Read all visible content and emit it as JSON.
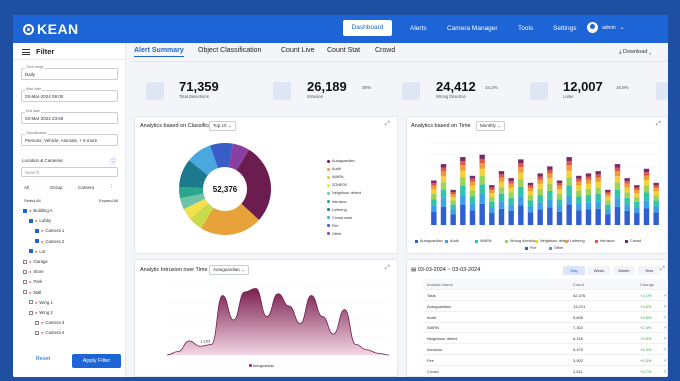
{
  "brand": "KEAN",
  "nav": {
    "active": "Dashboard",
    "items": [
      "Alerts",
      "Camera Manager",
      "Tools",
      "Settings"
    ],
    "user": "admin"
  },
  "sidebar": {
    "title": "Filter",
    "fields": [
      {
        "label": "Time range",
        "value": "Daily"
      },
      {
        "label": "Start date",
        "value": "03-Mar-2024 09:00"
      },
      {
        "label": "End date",
        "value": "03-Mar-2024 23:59"
      },
      {
        "label": "Classification",
        "value": "Persons, Vehicle, Animals, + 5 more"
      }
    ],
    "location_label": "Location & Cameras",
    "search_placeholder": "Search",
    "chips": [
      "All",
      "Group",
      "Camera"
    ],
    "select_all": "Select All",
    "expand_all": "Expand All",
    "tree": [
      {
        "label": "Building A",
        "level": 0,
        "checked": true
      },
      {
        "label": "Lobby",
        "level": 1,
        "checked": true
      },
      {
        "label": "Camera 1",
        "level": 2,
        "checked": true
      },
      {
        "label": "Camera 2",
        "level": 2,
        "checked": true
      },
      {
        "label": "Lot",
        "level": 1,
        "checked": true
      },
      {
        "label": "Garage",
        "level": 0,
        "checked": false
      },
      {
        "label": "Store",
        "level": 0,
        "checked": false
      },
      {
        "label": "Park",
        "level": 0,
        "checked": false
      },
      {
        "label": "Mall",
        "level": 0,
        "checked": false
      },
      {
        "label": "Wing 1",
        "level": 1,
        "checked": false
      },
      {
        "label": "Wing 2",
        "level": 1,
        "checked": false
      },
      {
        "label": "Camera 3",
        "level": 2,
        "checked": false
      },
      {
        "label": "Camera 4",
        "level": 2,
        "checked": false
      }
    ],
    "reset": "Reset",
    "apply": "Apply Filter"
  },
  "tabs": [
    "Alert Summary",
    "Object Classification",
    "Count Live",
    "Count Stat",
    "Crowd"
  ],
  "download": "Download",
  "kpis": [
    {
      "value": "71,359",
      "label": "Total Detections",
      "pct": ""
    },
    {
      "value": "26,189",
      "label": "Intrusion",
      "pct": "36%"
    },
    {
      "value": "24,412",
      "label": "Wrong Direction",
      "pct": "34.2%"
    },
    {
      "value": "12,007",
      "label": "Loiter",
      "pct": "16.8%"
    }
  ],
  "donut_card": {
    "title": "Analytics based on Classification",
    "select": "Top 10",
    "center": "52,376",
    "legend": [
      "Autoguardian",
      "Audit",
      "WARN",
      "ZONE05",
      "Neighbour detect",
      "Intrusion",
      "Loitering",
      "Crowd zone",
      "Fire",
      "Other"
    ]
  },
  "bar_card": {
    "title": "Analytics based on Time",
    "select": "Monthly",
    "legend": [
      "Autoguardian",
      "Audit",
      "WARN",
      "Wrong direction",
      "Neighbour detect",
      "Loitering",
      "Intrusion",
      "Crowd",
      "Fire",
      "Other"
    ]
  },
  "area_card": {
    "title": "Analytic Intrusion over Time",
    "select": "Autoguardian",
    "annotation": "1,103",
    "legend": "Autoguardian"
  },
  "table_card": {
    "title": "03-03-2024 ~ 03-03-2024",
    "buttons": [
      "Day",
      "Week",
      "Month",
      "Year"
    ],
    "headers": [
      "Analytic Name",
      "Count",
      "Change"
    ],
    "rows": [
      {
        "name": "Total",
        "count": "52,376",
        "change": "+2.1%"
      },
      {
        "name": "Autoguardian",
        "count": "13,221",
        "change": "+1.6%"
      },
      {
        "name": "Audit",
        "count": "9,845",
        "change": "+0.8%"
      },
      {
        "name": "WARN",
        "count": "7,302",
        "change": "+2.4%"
      },
      {
        "name": "Neighbour detect",
        "count": "6,118",
        "change": "+0.5%"
      },
      {
        "name": "Intrusion",
        "count": "5,470",
        "change": "+1.9%"
      },
      {
        "name": "Fire",
        "count": "3,902",
        "change": "+0.3%"
      },
      {
        "name": "Crowd",
        "count": "2,611",
        "change": "+0.7%"
      }
    ]
  },
  "chart_data": [
    {
      "type": "pie",
      "title": "Analytics based on Classification",
      "center_value": "52,376",
      "categories": [
        "Autoguardian",
        "Audit",
        "WARN",
        "ZONE05",
        "Neighbour detect",
        "Intrusion",
        "Loitering",
        "Crowd zone",
        "Fire",
        "Other"
      ],
      "values": [
        28,
        22,
        5,
        4,
        4,
        4,
        10,
        9,
        8,
        6
      ],
      "colors": [
        "#6b1d4f",
        "#e8a23a",
        "#c9d94a",
        "#f4e04d",
        "#6fc3a8",
        "#2ca58d",
        "#1d7a8c",
        "#4aa8e0",
        "#3a5cc7",
        "#8a3fa0"
      ]
    },
    {
      "type": "bar",
      "title": "Analytics based on Time",
      "categories": [
        "1",
        "2",
        "3",
        "4",
        "5",
        "6",
        "7",
        "8",
        "9",
        "10",
        "11",
        "12",
        "13",
        "14",
        "15",
        "16",
        "17",
        "18",
        "19",
        "20",
        "21",
        "22",
        "23",
        "24"
      ],
      "totals": [
        38,
        52,
        30,
        58,
        42,
        60,
        34,
        46,
        40,
        56,
        36,
        44,
        50,
        38,
        58,
        42,
        44,
        46,
        30,
        52,
        40,
        34,
        48,
        36
      ],
      "series_colors": [
        "#2f5fd0",
        "#3aa0e8",
        "#31c4a8",
        "#9bd35a",
        "#f2d13b",
        "#f09a3a",
        "#e2574c",
        "#7a2a68"
      ],
      "ylim": [
        0,
        70
      ]
    },
    {
      "type": "area",
      "title": "Analytic Intrusion over Time",
      "x": [
        0,
        1,
        2,
        3,
        4,
        5,
        6,
        7,
        8,
        9,
        10,
        11,
        12,
        13,
        14,
        15,
        16,
        17,
        18,
        19,
        20
      ],
      "values": [
        0,
        2,
        8,
        5,
        6,
        34,
        20,
        36,
        38,
        22,
        35,
        28,
        18,
        34,
        22,
        12,
        26,
        6,
        3,
        1,
        0
      ],
      "ylim": [
        0,
        40
      ]
    }
  ]
}
